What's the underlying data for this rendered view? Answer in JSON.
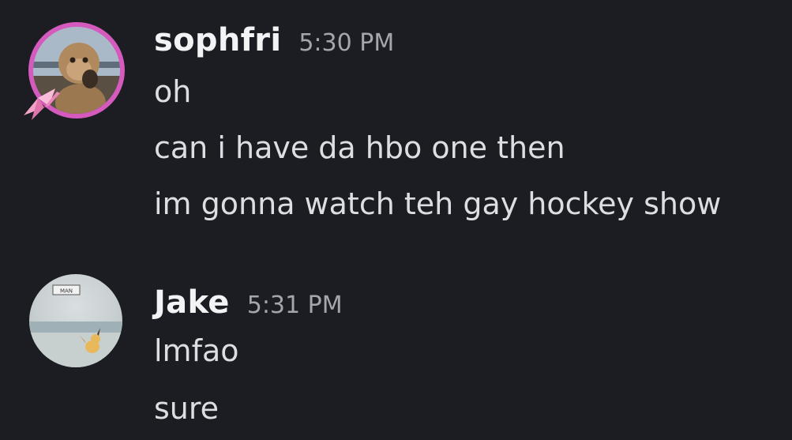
{
  "messages": [
    {
      "author": "sophfri",
      "timestamp": "5:30 PM",
      "lines": [
        "oh",
        "can i have da hbo one then",
        "im gonna watch teh gay hockey show"
      ],
      "avatar_icon": "monkey-avatar-icon",
      "avatar_ring_color": "#d45bbd"
    },
    {
      "author": "Jake",
      "timestamp": "5:31 PM",
      "lines": [
        "lmfao",
        "sure"
      ],
      "avatar_icon": "pikachu-beach-avatar-icon",
      "avatar_badge_text": "MAN"
    }
  ],
  "colors": {
    "background": "#1c1d22",
    "username": "#f2f3f5",
    "timestamp": "#a3a6ae",
    "message": "#dcdee1"
  }
}
